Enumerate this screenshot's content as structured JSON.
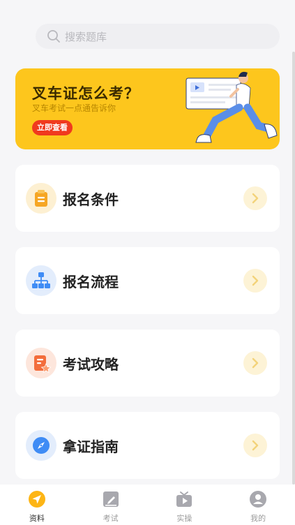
{
  "search": {
    "placeholder": "搜索题库"
  },
  "banner": {
    "title": "叉车证怎么考？",
    "subtitle": "叉车考试一点通告诉你",
    "button_label": "立即查看"
  },
  "cards": [
    {
      "label": "报名条件",
      "icon": "clipboard-icon",
      "color": "#f6a623"
    },
    {
      "label": "报名流程",
      "icon": "flowchart-icon",
      "color": "#3f8cf5"
    },
    {
      "label": "考试攻略",
      "icon": "strategy-doc-icon",
      "color": "#f36d3b"
    },
    {
      "label": "拿证指南",
      "icon": "compass-icon",
      "color": "#3f8cf5"
    }
  ],
  "tabbar": {
    "items": [
      {
        "label": "资料",
        "icon": "navigation-arrow-icon",
        "active": true
      },
      {
        "label": "考试",
        "icon": "edit-icon",
        "active": false
      },
      {
        "label": "实操",
        "icon": "tv-play-icon",
        "active": false
      },
      {
        "label": "我的",
        "icon": "user-icon",
        "active": false
      }
    ]
  },
  "colors": {
    "accent": "#fdc61d",
    "button_red": "#f03a1e"
  }
}
